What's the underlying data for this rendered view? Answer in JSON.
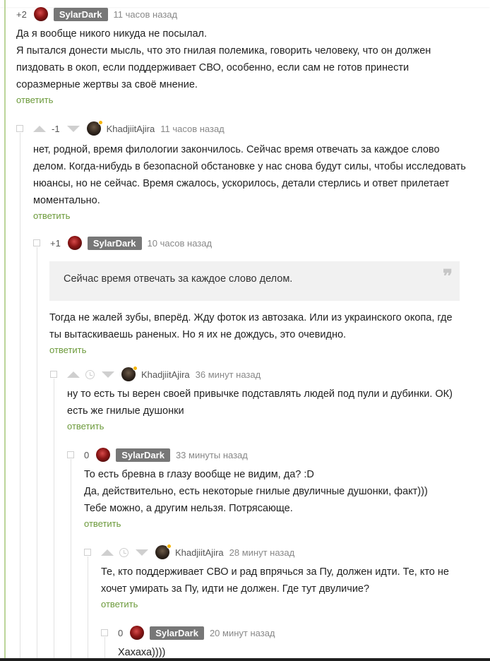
{
  "comments": [
    {
      "score": "+2",
      "author": "SylarDark",
      "time": "11 часов назад",
      "lines": [
        "Да я вообще никого никуда не посылал.",
        "Я пытался донести мысль, что это гнилая полемика, говорить человеку, что он должен",
        "пиздовать в окоп, если поддерживает СВО, особенно, если сам не готов принести",
        "соразмерные жертвы за своё мнение."
      ],
      "reply": "ответить"
    },
    {
      "score": "-1",
      "author": "KhadjiitAjira",
      "time": "11 часов назад",
      "lines": [
        "нет, родной, время филологии закончилось. Сейчас время отвечать за каждое слово",
        "делом. Когда-нибудь в безопасной обстановке у нас снова будут силы, чтобы исследовать",
        "нюансы, но не сейчас. Время сжалось, ускорилось, детали стерлись и ответ прилетает",
        "моментально."
      ],
      "reply": "ответить"
    },
    {
      "score": "+1",
      "author": "SylarDark",
      "time": "10 часов назад",
      "quote": "Сейчас время отвечать за каждое слово делом.",
      "quote_icon": "quote-icon",
      "lines": [
        "Тогда не жалей зубы, вперёд. Жду фоток из автозака. Или из украинского окопа, где",
        "ты вытаскиваешь раненых. Но я их не дождусь, это очевидно."
      ],
      "reply": "ответить"
    },
    {
      "score": "",
      "author": "KhadjiitAjira",
      "time": "36 минут назад",
      "lines": [
        "ну то есть ты верен своей привычке подставлять людей под пули и дубинки. ОК)",
        "есть же гнилые душонки"
      ],
      "reply": "ответить"
    },
    {
      "score": "0",
      "author": "SylarDark",
      "time": "33 минуты назад",
      "lines": [
        "То есть бревна в глазу вообще не видим, да? :D",
        "Да, действительно, есть некоторые гнилые двуличные душонки, факт)))",
        "Тебе можно, а другим нельзя. Потрясающе."
      ],
      "reply": "ответить"
    },
    {
      "score": "",
      "author": "KhadjiitAjira",
      "time": "28 минут назад",
      "lines": [
        "Те, кто поддерживает СВО и рад впрячься за Пу, должен идти. Те, кто не",
        "хочет умирать за Пу, идти не должен. Где тут двуличие?"
      ],
      "reply": "ответить"
    },
    {
      "score": "0",
      "author": "SylarDark",
      "time": "20 минут назад",
      "lines": [
        "Хахаха))))"
      ]
    }
  ],
  "colors": {
    "reply_link": "#6c9a3b",
    "badge_bg": "#777777",
    "online_dot": "#f5b400"
  }
}
